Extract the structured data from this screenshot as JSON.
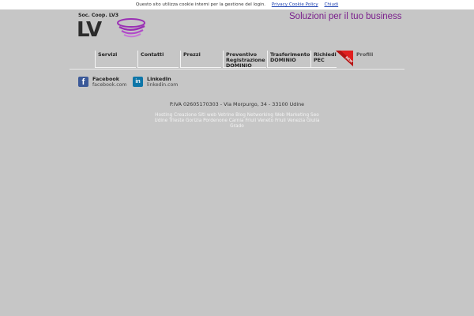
{
  "cookie_bar": {
    "text": "Questo sito utilizza cookie interni per la gestione del login.",
    "policy_link": "Privacy Cookie Policy",
    "close_link": "Chiudi"
  },
  "header": {
    "coop_name": "Soc. Coop. LV3",
    "logo_text": "LV",
    "tagline": "Soluzioni per il tuo business"
  },
  "nav": {
    "items": [
      {
        "label": "Servizi"
      },
      {
        "label": "Contatti"
      },
      {
        "label": "Prezzi"
      },
      {
        "label": "Preventivo\nRegistrazione\nDOMINIO"
      },
      {
        "label": "Trasferimento\nDOMINIO"
      },
      {
        "label": "Richiedi\nPEC"
      },
      {
        "label": "Profili"
      }
    ],
    "new_badge": "NEW"
  },
  "social": [
    {
      "name": "Facebook",
      "url": "facebook.com",
      "icon": "facebook-icon",
      "icon_letter": "f",
      "color": "#3b5998"
    },
    {
      "name": "LinkedIn",
      "url": "linkedin.com",
      "icon": "linkedin-icon",
      "icon_letter": "in",
      "color": "#0e76a8"
    }
  ],
  "footer": {
    "piva": "P.IVA 02605170303 - Via Morpurgo, 34 - 33100 Udine",
    "keywords": "Hosting Creazione Siti web Vetrine Blog Networking Web Marketing Seo Udine Trieste Gorizia Pordenone Carnia Friuli Veneto Friuli Venezia Giulia Grado"
  },
  "colors": {
    "background": "#c6c6c6",
    "tagline": "#7a1f8c",
    "link": "#1a3fb0",
    "ribbon": "#e02020"
  }
}
